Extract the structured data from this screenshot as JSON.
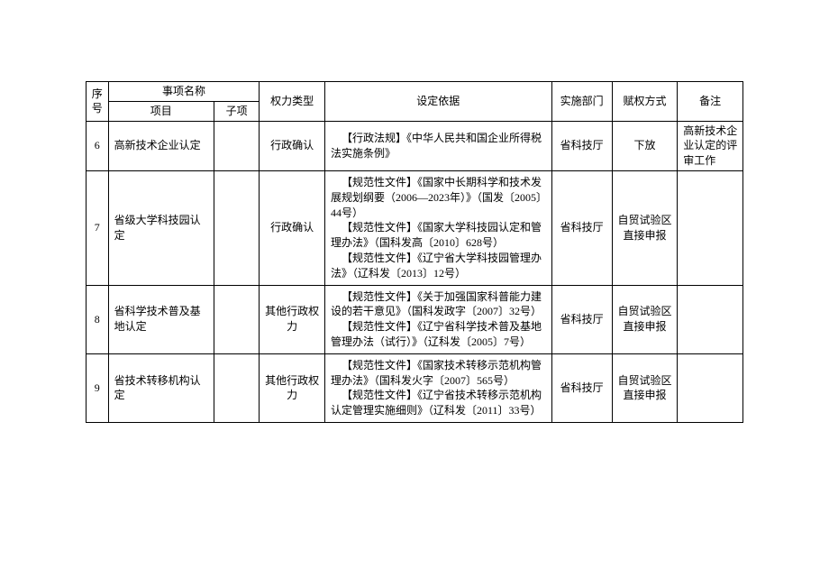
{
  "headers": {
    "seq": "序号",
    "item_name": "事项名称",
    "project": "项目",
    "subitem": "子项",
    "power_type": "权力类型",
    "basis": "设定依据",
    "department": "实施部门",
    "auth_mode": "赋权方式",
    "remark": "备注"
  },
  "rows": [
    {
      "seq": "6",
      "project": "高新技术企业认定",
      "subitem": "",
      "power_type": "行政确认",
      "basis_lines": [
        "【行政法规】《中华人民共和国企业所得税法实施条例》"
      ],
      "department": "省科技厅",
      "auth_mode": "下放",
      "remark": "高新技术企业认定的评审工作"
    },
    {
      "seq": "7",
      "project": "省级大学科技园认定",
      "subitem": "",
      "power_type": "行政确认",
      "basis_lines": [
        "【规范性文件】《国家中长期科学和技术发展规划纲要（2006—2023年）》（国发〔2005〕44号）",
        "【规范性文件】《国家大学科技园认定和管理办法》（国科发高〔2010〕628号）",
        "【规范性文件】《辽宁省大学科技园管理办法》（辽科发〔2013〕12号）"
      ],
      "department": "省科技厅",
      "auth_mode": "自贸试验区直接申报",
      "remark": ""
    },
    {
      "seq": "8",
      "project": "省科学技术普及基地认定",
      "subitem": "",
      "power_type": "其他行政权力",
      "basis_lines": [
        "【规范性文件】《关于加强国家科普能力建设的若干意见》（国科发政字〔2007〕32号）",
        "【规范性文件】《辽宁省科学技术普及基地管理办法（试行）》（辽科发〔2005〕7号）"
      ],
      "department": "省科技厅",
      "auth_mode": "自贸试验区直接申报",
      "remark": ""
    },
    {
      "seq": "9",
      "project": "省技术转移机构认定",
      "subitem": "",
      "power_type": "其他行政权力",
      "basis_lines": [
        "【规范性文件】《国家技术转移示范机构管理办法》（国科发火字〔2007〕565号）",
        "【规范性文件】《辽宁省技术转移示范机构认定管理实施细则》（辽科发〔2011〕33号）"
      ],
      "department": "省科技厅",
      "auth_mode": "自贸试验区直接申报",
      "remark": ""
    }
  ]
}
